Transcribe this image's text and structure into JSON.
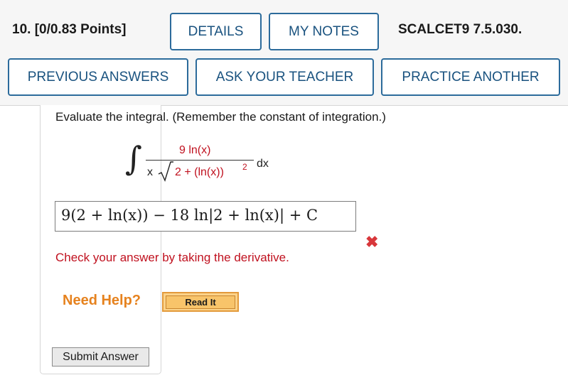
{
  "header": {
    "question_label": "10.  [0/0.83 Points]",
    "details_label": "DETAILS",
    "my_notes_label": "MY NOTES",
    "source_label": "SCALCET9 7.5.030.",
    "previous_answers_label": "PREVIOUS ANSWERS",
    "ask_teacher_label": "ASK YOUR TEACHER",
    "practice_another_label": "PRACTICE ANOTHER"
  },
  "question": {
    "prompt": "Evaluate the integral. (Remember the constant of integration.)",
    "integrand_numerator": "9 ln(x)",
    "integrand_denominator_x": "x",
    "integrand_denominator_inner": "2 + (ln(x))",
    "integrand_denominator_exponent": "2",
    "differential": "dx"
  },
  "answer": {
    "value": "9(2 + ln(x)) − 18 ln|2 + ln(x)| + C",
    "status_icon": "incorrect-x-icon",
    "feedback": "Check your answer by taking the derivative."
  },
  "help": {
    "need_help_label": "Need Help?",
    "read_it_label": "Read It"
  },
  "submit_label": "Submit Answer",
  "colors": {
    "button_border": "#2c6b9b",
    "button_text": "#19527f",
    "error_red": "#c0111f",
    "wrong_icon": "#d8373b",
    "help_orange": "#e6821e"
  }
}
